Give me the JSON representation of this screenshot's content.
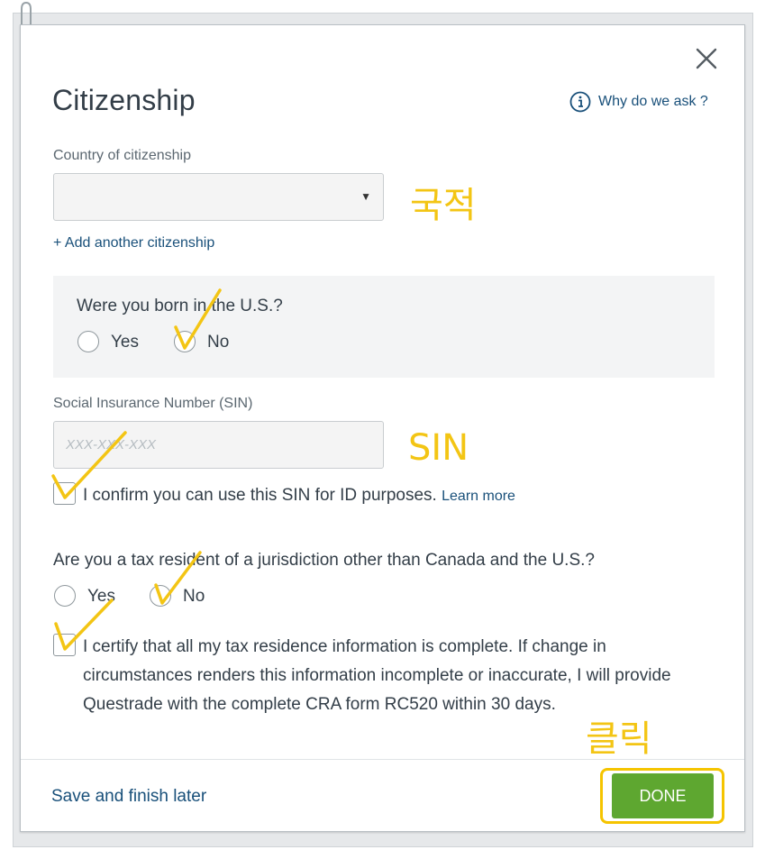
{
  "dialog": {
    "title": "Citizenship",
    "why_link": "Why do we ask ?"
  },
  "citizenship": {
    "country_label": "Country of citizenship",
    "country_value": "",
    "add_link": "+ Add another citizenship"
  },
  "born_us": {
    "question": "Were you born in the U.S.?",
    "options": [
      "Yes",
      "No"
    ],
    "selected": "No"
  },
  "sin": {
    "label": "Social Insurance Number (SIN)",
    "placeholder": "XXX-XXX-XXX",
    "confirm_text": "I confirm you can use this SIN for ID purposes.",
    "learn_more": "Learn more",
    "confirm_checked": true
  },
  "tax_resident": {
    "question": "Are you a tax resident of a jurisdiction other than Canada and the U.S.?",
    "options": [
      "Yes",
      "No"
    ],
    "selected": "No",
    "certify_lines": [
      "I certify that all my tax residence information is complete. If change in",
      "circumstances renders this information incomplete or inaccurate, I will provide",
      "Questrade with the complete CRA form RC520 within 30 days."
    ],
    "certify_checked": true
  },
  "footer": {
    "save_later": "Save and finish later",
    "done": "DONE"
  },
  "annotations": {
    "nationality": "국적",
    "sin": "SIN",
    "click": "클릭",
    "color": "#f3c514"
  },
  "colors": {
    "link": "#19507a",
    "done_button": "#5ea730",
    "highlight": "#f5c400"
  }
}
